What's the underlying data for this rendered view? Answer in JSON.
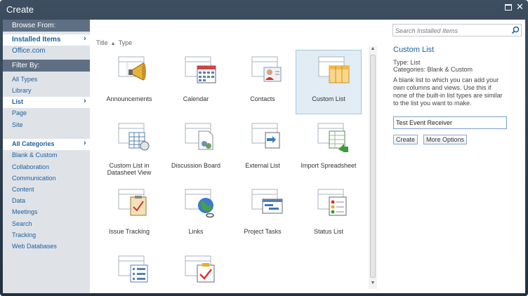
{
  "window": {
    "title": "Create"
  },
  "nav": {
    "browse_header": "Browse From:",
    "browse_items": [
      {
        "label": "Installed Items",
        "selected": true
      },
      {
        "label": "Office.com"
      }
    ],
    "filter_header": "Filter By:",
    "filter_items": [
      {
        "label": "All Types"
      },
      {
        "label": "Library"
      },
      {
        "label": "List",
        "selected": true
      },
      {
        "label": "Page"
      },
      {
        "label": "Site"
      }
    ],
    "categories": [
      {
        "label": "All Categories",
        "selected": true
      },
      {
        "label": "Blank & Custom"
      },
      {
        "label": "Collaboration"
      },
      {
        "label": "Communication"
      },
      {
        "label": "Content"
      },
      {
        "label": "Data"
      },
      {
        "label": "Meetings"
      },
      {
        "label": "Search"
      },
      {
        "label": "Tracking"
      },
      {
        "label": "Web Databases"
      }
    ]
  },
  "sort": {
    "title": "Title",
    "sort_arrow": "▲",
    "type": "Type"
  },
  "tiles": [
    {
      "label": "Announcements",
      "icon": "announcements-icon"
    },
    {
      "label": "Calendar",
      "icon": "calendar-icon"
    },
    {
      "label": "Contacts",
      "icon": "contacts-icon"
    },
    {
      "label": "Custom List",
      "icon": "custom-list-icon",
      "selected": true
    },
    {
      "label": "Custom List in Datasheet View",
      "icon": "datasheet-icon"
    },
    {
      "label": "Discussion Board",
      "icon": "discussion-board-icon"
    },
    {
      "label": "External List",
      "icon": "external-list-icon"
    },
    {
      "label": "Import Spreadsheet",
      "icon": "import-spreadsheet-icon"
    },
    {
      "label": "Issue Tracking",
      "icon": "issue-tracking-icon"
    },
    {
      "label": "Links",
      "icon": "links-icon"
    },
    {
      "label": "Project Tasks",
      "icon": "project-tasks-icon"
    },
    {
      "label": "Status List",
      "icon": "status-list-icon"
    },
    {
      "label": "",
      "icon": "survey-icon"
    },
    {
      "label": "",
      "icon": "tasks-icon"
    }
  ],
  "details": {
    "search_placeholder": "Search Installed Items",
    "title": "Custom List",
    "type_line": "Type: List",
    "categories_line": "Categories: Blank & Custom",
    "description": "A blank list to which you can add your own columns and views. Use this if none of the built-in list types are similar to the list you want to make.",
    "name_value": "Test Event Receiver",
    "create_label": "Create",
    "more_options_label": "More Options"
  },
  "colors": {
    "accent": "#1c5f9f",
    "nav_header": "#5f6f83",
    "selected_tile": "#e1ecf5"
  }
}
